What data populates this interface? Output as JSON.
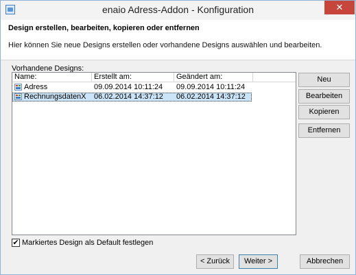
{
  "window": {
    "title": "enaio  Adress-Addon - Konfiguration",
    "close_glyph": "✕"
  },
  "header": {
    "title": "Design erstellen, bearbeiten, kopieren oder entfernen",
    "description": "Hier können Sie neue Designs erstellen oder vorhandene Designs auswählen und bearbeiten."
  },
  "designs": {
    "label": "Vorhandene Designs:",
    "columns": [
      "Name:",
      "Erstellt am:",
      "Geändert am:"
    ],
    "rows": [
      {
        "name": "Adress",
        "created": "09.09.2014 10:11:24",
        "modified": "09.09.2014 10:11:24",
        "selected": false
      },
      {
        "name": "RechnungsdatenX",
        "created": "06.02.2014 14:37:12",
        "modified": "06.02.2014 14:37:12",
        "selected": true
      }
    ]
  },
  "side_buttons": {
    "new": "Neu",
    "edit": "Bearbeiten",
    "copy": "Kopieren",
    "remove": "Entfernen"
  },
  "default_checkbox": {
    "label": "Markiertes Design als Default festlegen",
    "checked": true,
    "glyph": "✔"
  },
  "footer": {
    "back": "< Zurück",
    "next": "Weiter >",
    "cancel": "Abbrechen"
  }
}
